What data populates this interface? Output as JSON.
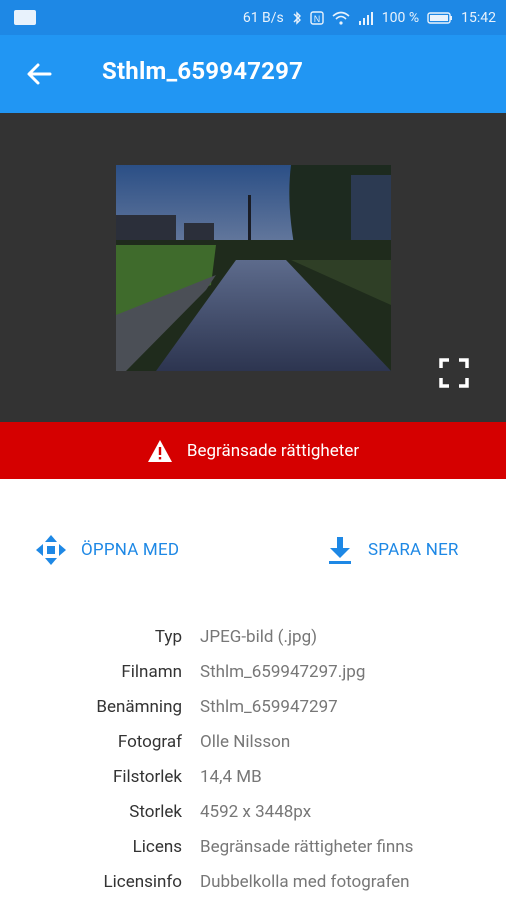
{
  "status_bar": {
    "network_speed": "61 B/s",
    "battery": "100 %",
    "time": "15:42",
    "icons": [
      "notification-icon",
      "bluetooth-icon",
      "nfc-icon",
      "wifi-icon",
      "signal-icon",
      "battery-icon"
    ]
  },
  "app_bar": {
    "title": "Sthlm_659947297",
    "back_icon": "arrow-left-icon"
  },
  "preview": {
    "fullscreen_icon": "fullscreen-icon"
  },
  "warning": {
    "text": "Begränsade rättigheter",
    "icon": "warning-triangle-icon",
    "color": "#d50000"
  },
  "actions": {
    "open_with": "ÖPPNA MED",
    "download": "SPARA NER",
    "accent": "#1e88e5"
  },
  "info": [
    {
      "key": "Typ",
      "value": "JPEG-bild (.jpg)"
    },
    {
      "key": "Filnamn",
      "value": "Sthlm_659947297.jpg"
    },
    {
      "key": "Benämning",
      "value": "Sthlm_659947297"
    },
    {
      "key": "Fotograf",
      "value": "Olle Nilsson"
    },
    {
      "key": "Filstorlek",
      "value": "14,4 MB"
    },
    {
      "key": "Storlek",
      "value": "4592 x 3448px"
    },
    {
      "key": "Licens",
      "value": "Begränsade rättigheter finns"
    },
    {
      "key": "Licensinfo",
      "value": "Dubbelkolla med fotografen"
    }
  ]
}
